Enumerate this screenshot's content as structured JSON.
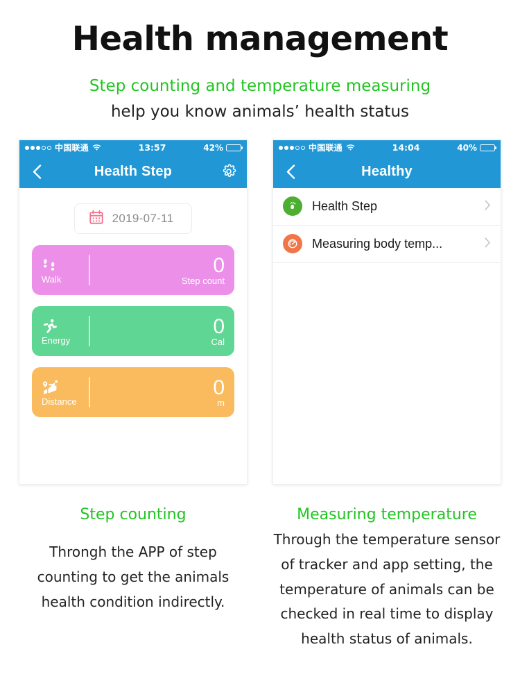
{
  "header": {
    "title": "Health management",
    "subtitle_green": "Step counting and temperature measuring",
    "subtitle_dark": "help you know animals’ health status"
  },
  "colors": {
    "green": "#22c522",
    "nav_blue": "#2197d5",
    "card_pink": "#ec8fe8",
    "card_green": "#5fd693",
    "card_orange": "#f9bb5e",
    "icon_green": "#4caf32",
    "icon_orange": "#f0764a",
    "calendar_pink": "#f76f8e"
  },
  "left_phone": {
    "status_bar": {
      "signal_filled": 3,
      "signal_empty": 2,
      "carrier": "中国联通",
      "wifi": "wifi-icon",
      "time": "13:57",
      "battery_percent": "42%",
      "battery_level": 42
    },
    "nav": {
      "back": "chevron-left-icon",
      "title": "Health Step",
      "settings": "gear-icon"
    },
    "date_selector": {
      "icon": "calendar-icon",
      "value": "2019-07-11"
    },
    "cards": [
      {
        "icon": "footprints-icon",
        "label": "Walk",
        "value": "0",
        "unit": "Step count",
        "color": "#ec8fe8"
      },
      {
        "icon": "running-icon",
        "label": "Energy",
        "value": "0",
        "unit": "Cal",
        "color": "#5fd693"
      },
      {
        "icon": "route-pin-icon",
        "label": "Distance",
        "value": "0",
        "unit": "m",
        "color": "#f9bb5e"
      }
    ]
  },
  "right_phone": {
    "status_bar": {
      "signal_filled": 3,
      "signal_empty": 2,
      "carrier": "中国联通",
      "wifi": "wifi-icon",
      "time": "14:04",
      "battery_percent": "40%",
      "battery_level": 40
    },
    "nav": {
      "back": "chevron-left-icon",
      "title": "Healthy"
    },
    "list_items": [
      {
        "icon": "footprint-circle-icon",
        "icon_color": "#4caf32",
        "label": "Health Step",
        "chevron": "chevron-right-icon"
      },
      {
        "icon": "thermometer-gauge-icon",
        "icon_color": "#f0764a",
        "label": "Measuring body temp...",
        "chevron": "chevron-right-icon"
      }
    ]
  },
  "captions": {
    "left": {
      "title": "Step counting",
      "body": "Throngh the APP of  step counting to get the animals health condition indirectly."
    },
    "right": {
      "title": "Measuring temperature",
      "body": "Through the temperature sensor of tracker and app setting, the temperature of animals can be checked in real time to display health status of animals."
    }
  }
}
